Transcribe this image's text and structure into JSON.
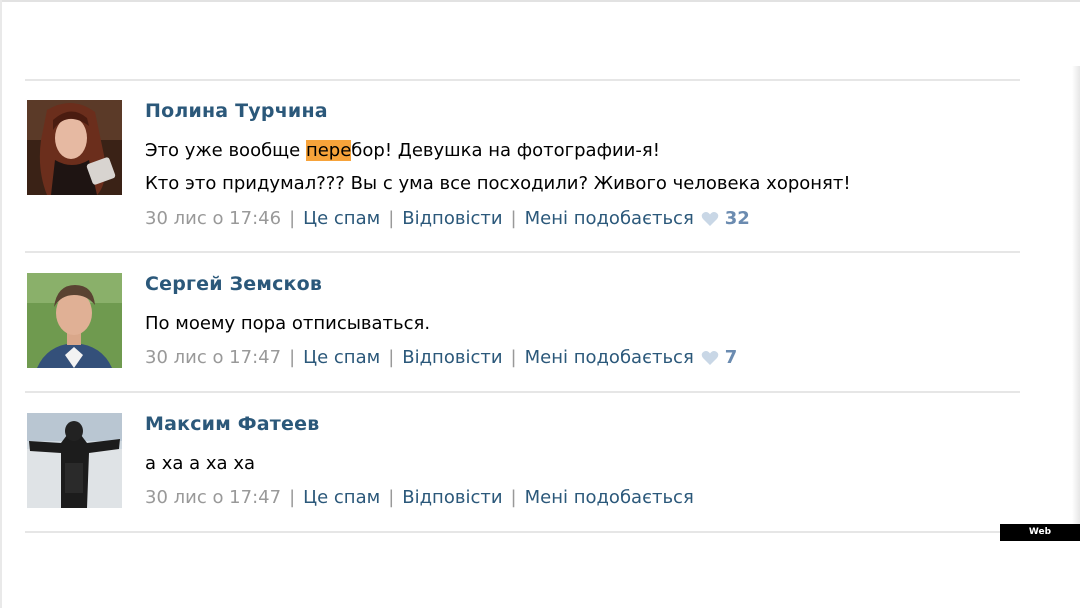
{
  "comments": [
    {
      "author": "Полина Турчина",
      "avatar_icon": "avatar-girl-photo",
      "line1_before": "Это уже вообще ",
      "line1_highlight": "пере",
      "line1_after": "бор! Девушка на фотографии-я!",
      "line2": "Кто это придумал??? Вы с ума все посходили? Живого человека хоронят!",
      "date": "30 лис о 17:46",
      "spam": "Це спам",
      "reply": "Відповісти",
      "like": "Мені подобається",
      "likes": "32"
    },
    {
      "author": "Сергей Земсков",
      "avatar_icon": "avatar-man-photo",
      "line1": "По моему пора отписываться.",
      "date": "30 лис о 17:47",
      "spam": "Це спам",
      "reply": "Відповісти",
      "like": "Мені подобається",
      "likes": "7"
    },
    {
      "author": "Максим Фатеев",
      "avatar_icon": "avatar-figure-photo",
      "line1": "а ха а ха ха",
      "date": "30 лис о 17:47",
      "spam": "Це спам",
      "reply": "Відповісти",
      "like": "Мені подобається"
    }
  ],
  "separator": "|",
  "watermark": "Web Screenshot",
  "colors": {
    "author": "#2b587a",
    "link": "#2b587a",
    "meta_gray": "#999999",
    "like_count": "#6b8bb0",
    "highlight": "#f7a33a"
  }
}
